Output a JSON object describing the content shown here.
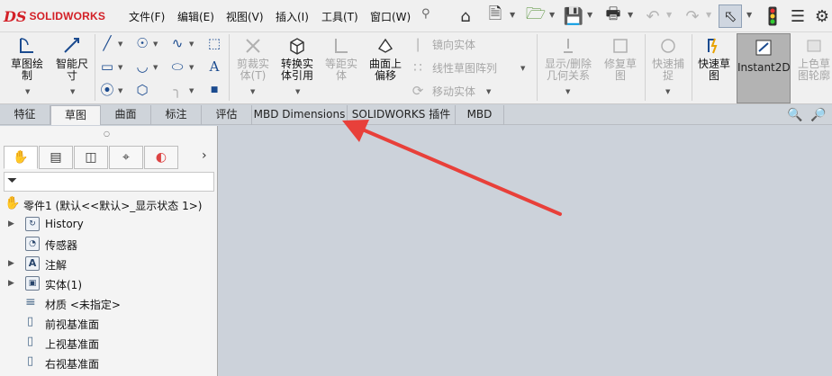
{
  "app": {
    "logo_mark": "DS",
    "logo_text": "SOLIDWORKS"
  },
  "menu": [
    "文件(F)",
    "编辑(E)",
    "视图(V)",
    "插入(I)",
    "工具(T)",
    "窗口(W)"
  ],
  "quick_access": [
    "home-icon",
    "new-document-icon",
    "open-icon",
    "save-icon",
    "print-icon",
    "undo-icon",
    "redo-icon",
    "select-cursor-icon",
    "traffic-light-icon",
    "options-icon"
  ],
  "ribbon": {
    "sketch": "草图绘\n制",
    "smart_dimension": "智能尺\n寸",
    "trim": "剪裁实\n体(T)",
    "convert": "转换实\n体引用",
    "offset_disabled": "等距实\n体",
    "offset_surface": "曲面上\n偏移",
    "mirror": "镜向实体",
    "linear_pattern": "线性草图阵列",
    "move": "移动实体",
    "display_relations": "显示/删除\n几何关系",
    "repair": "修复草\n图",
    "quick_snaps": "快速捕\n捉",
    "rapid_sketch": "快速草\n图",
    "instant2d": "Instant2D",
    "shaded_contours": "上色草\n图轮廓"
  },
  "tabs": [
    "特征",
    "草图",
    "曲面",
    "标注",
    "评估",
    "MBD Dimensions",
    "SOLIDWORKS 插件",
    "MBD"
  ],
  "active_tab": "草图",
  "tree": {
    "root": "零件1  (默认<<默认>_显示状态 1>)",
    "items": [
      "History",
      "传感器",
      "注解",
      "实体(1)",
      "材质 <未指定>",
      "前视基准面",
      "上视基准面",
      "右视基准面"
    ]
  },
  "colors": {
    "accent_red": "#e8403a",
    "active_tab": "#f4f4f4",
    "viewport": "#ccd2da"
  }
}
